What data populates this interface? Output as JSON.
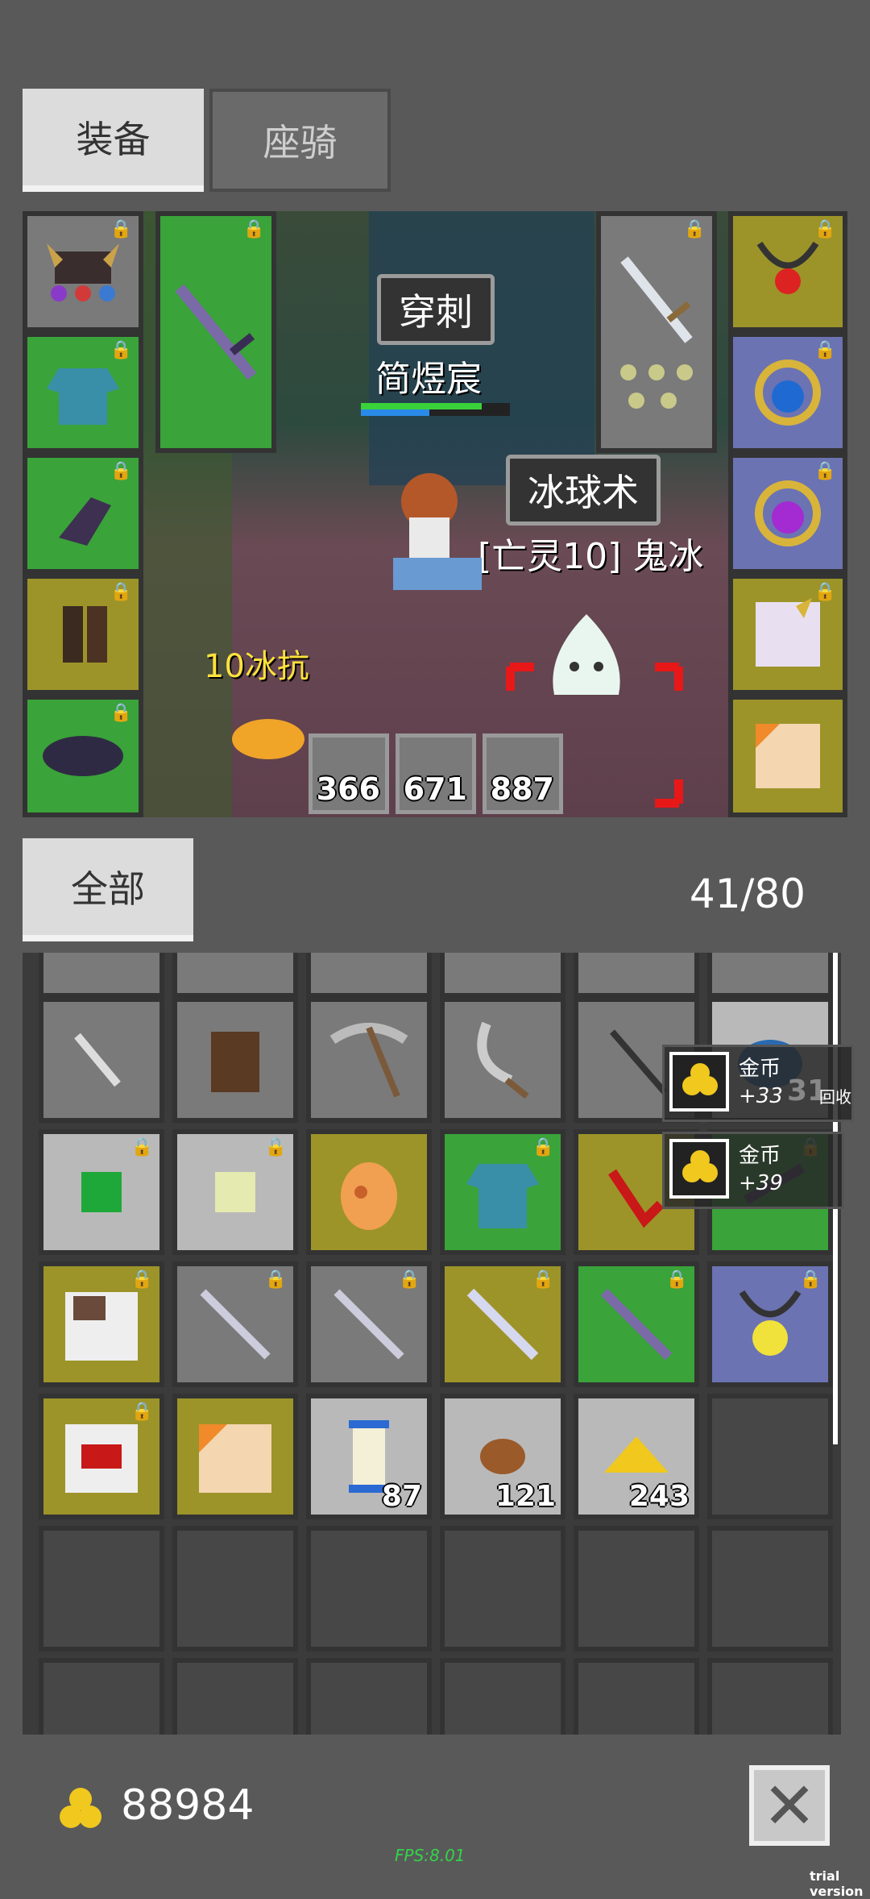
{
  "tabs": {
    "equip": "装备",
    "mount": "座骑"
  },
  "scene": {
    "skill_top": "穿刺",
    "player_name": "简煜宸",
    "skill_enemy": "冰球术",
    "enemy_name": "[亡灵10] 鬼冰",
    "resist_label": "10冰抗",
    "counters": [
      "366",
      "671",
      "887"
    ]
  },
  "filter": {
    "label": "全部",
    "capacity": "41/80"
  },
  "toasts": [
    {
      "title": "金币",
      "amount": "+33",
      "extra": "31",
      "extra_label": "回收"
    },
    {
      "title": "金币",
      "amount": "+39"
    }
  ],
  "inventory": {
    "quantities": {
      "scroll": "87",
      "ore": "121",
      "gold_pile": "243"
    }
  },
  "footer": {
    "gold": "88984",
    "close": "✕",
    "fps": "FPS:8.01",
    "trial": "trial version"
  },
  "colors": {
    "rarity_green": "#3aa33a",
    "rarity_gold": "#9c9429",
    "rarity_blue": "#6b73b2",
    "rarity_gray": "#b9b9b9"
  }
}
